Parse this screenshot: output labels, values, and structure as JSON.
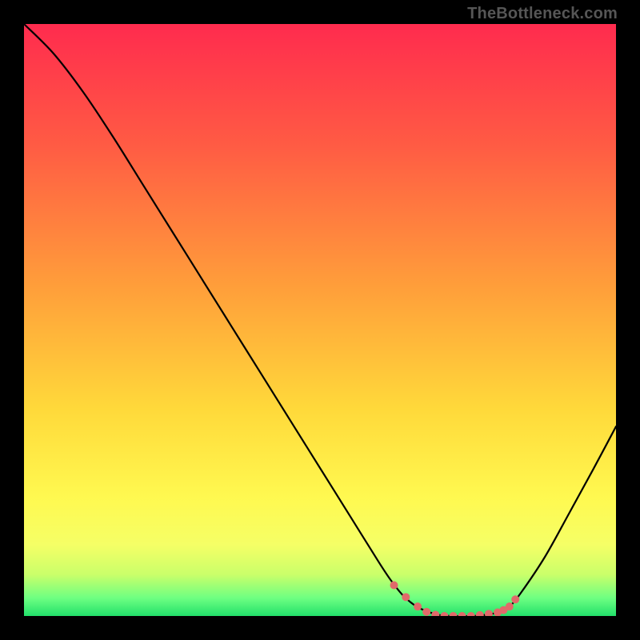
{
  "attribution": "TheBottleneck.com",
  "chart_data": {
    "type": "line",
    "title": "",
    "xlabel": "",
    "ylabel": "",
    "xlim": [
      0,
      100
    ],
    "ylim": [
      0,
      100
    ],
    "background_gradient": {
      "stops": [
        {
          "offset": 0.0,
          "color": "#ff2b4e"
        },
        {
          "offset": 0.2,
          "color": "#ff5a44"
        },
        {
          "offset": 0.45,
          "color": "#ffa03a"
        },
        {
          "offset": 0.65,
          "color": "#ffd93a"
        },
        {
          "offset": 0.8,
          "color": "#fff950"
        },
        {
          "offset": 0.88,
          "color": "#f5ff66"
        },
        {
          "offset": 0.93,
          "color": "#caff6a"
        },
        {
          "offset": 0.97,
          "color": "#6dff82"
        },
        {
          "offset": 1.0,
          "color": "#22e06a"
        }
      ]
    },
    "series": [
      {
        "name": "bottleneck-curve",
        "color": "#000000",
        "x": [
          0,
          5,
          10,
          15,
          20,
          25,
          30,
          35,
          40,
          45,
          50,
          55,
          60,
          62,
          64,
          66,
          68,
          70,
          72,
          74,
          76,
          78,
          80,
          82,
          84,
          88,
          92,
          96,
          100
        ],
        "y": [
          100,
          95,
          88.5,
          81,
          73,
          65,
          57,
          49,
          41,
          33,
          25,
          17,
          9,
          6,
          3.5,
          1.8,
          0.8,
          0.2,
          0,
          0,
          0,
          0.2,
          0.6,
          1.6,
          4,
          10,
          17.2,
          24.5,
          32
        ]
      }
    ],
    "markers": {
      "name": "highlight-segment",
      "color": "#e06a6a",
      "radius": 5,
      "x": [
        62.5,
        64.5,
        66.5,
        68,
        69.5,
        71,
        72.5,
        74,
        75.5,
        77,
        78.5,
        80,
        81,
        82,
        83
      ],
      "y": [
        5.2,
        3.2,
        1.6,
        0.7,
        0.2,
        0,
        0,
        0,
        0,
        0.15,
        0.35,
        0.6,
        1.0,
        1.6,
        2.8
      ]
    }
  }
}
